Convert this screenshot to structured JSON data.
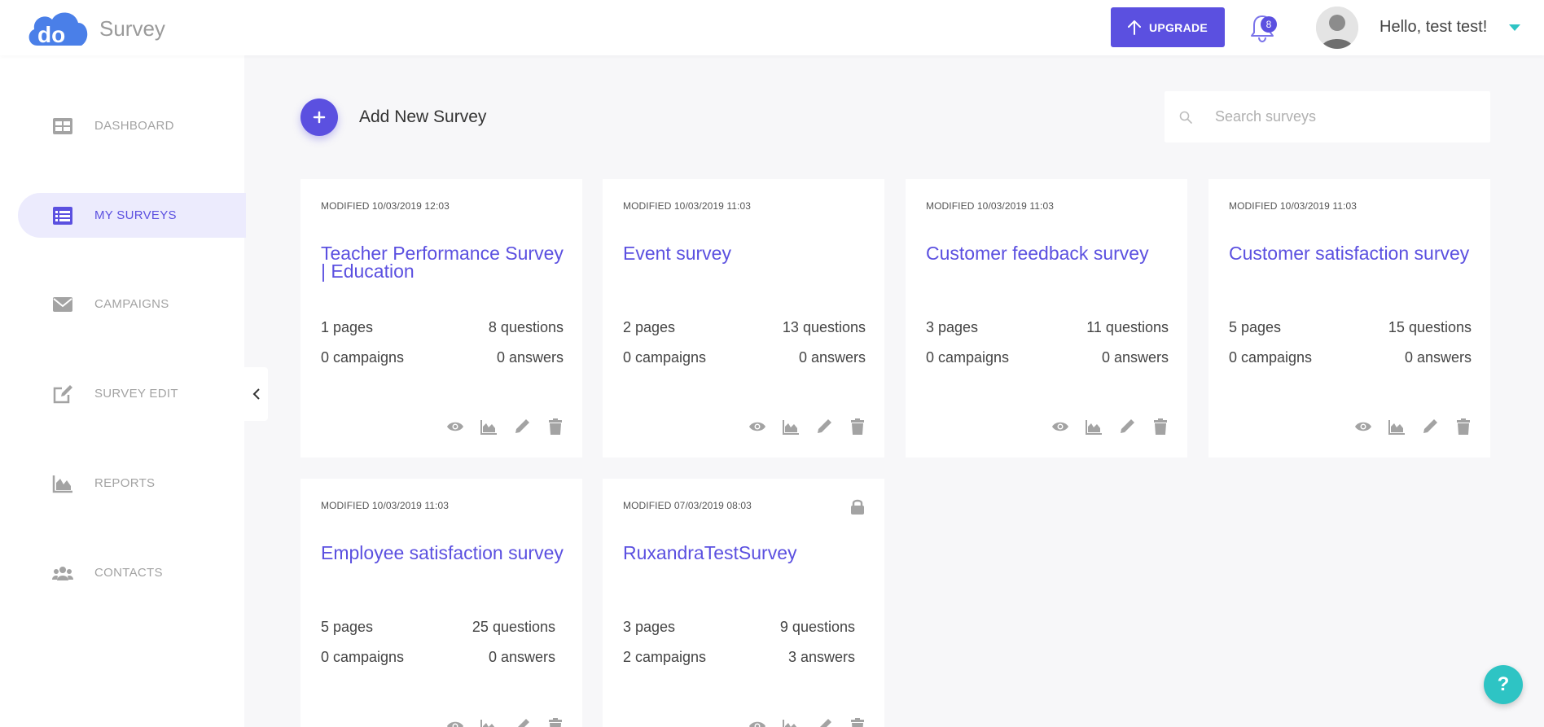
{
  "header": {
    "logo_text": "do",
    "app_title": "Survey",
    "upgrade_label": "UPGRADE",
    "notification_count": "8",
    "greeting": "Hello, test test!"
  },
  "sidebar": {
    "items": [
      {
        "label": "DASHBOARD",
        "icon": "dashboard-icon"
      },
      {
        "label": "MY SURVEYS",
        "icon": "list-icon",
        "active": true
      },
      {
        "label": "CAMPAIGNS",
        "icon": "envelope-icon"
      },
      {
        "label": "SURVEY EDIT",
        "icon": "edit-icon"
      },
      {
        "label": "REPORTS",
        "icon": "area-chart-icon"
      },
      {
        "label": "CONTACTS",
        "icon": "users-icon"
      }
    ]
  },
  "main": {
    "add_label": "Add New Survey",
    "search_placeholder": "Search surveys",
    "surveys": [
      {
        "modified": "MODIFIED 10/03/2019 12:03",
        "title": "Teacher Performance Survey | Education",
        "pages": "1 pages",
        "questions": "8 questions",
        "campaigns": "0 campaigns",
        "answers": "0 answers"
      },
      {
        "modified": "MODIFIED 10/03/2019 11:03",
        "title": "Event survey",
        "pages": "2 pages",
        "questions": "13 questions",
        "campaigns": "0 campaigns",
        "answers": "0 answers"
      },
      {
        "modified": "MODIFIED 10/03/2019 11:03",
        "title": "Customer feedback survey",
        "pages": "3 pages",
        "questions": "11 questions",
        "campaigns": "0 campaigns",
        "answers": "0 answers"
      },
      {
        "modified": "MODIFIED 10/03/2019 11:03",
        "title": "Customer satisfaction survey",
        "pages": "5 pages",
        "questions": "15 questions",
        "campaigns": "0 campaigns",
        "answers": "0 answers"
      },
      {
        "modified": "MODIFIED 10/03/2019 11:03",
        "title": "Employee satisfaction survey",
        "pages": "5 pages",
        "questions": "25 questions",
        "campaigns": "0 campaigns",
        "answers": "0 answers"
      },
      {
        "modified": "MODIFIED 07/03/2019 08:03",
        "title": "RuxandraTestSurvey",
        "pages": "3 pages",
        "questions": "9 questions",
        "campaigns": "2 campaigns",
        "answers": "3 answers",
        "locked": true
      }
    ]
  },
  "help_label": "?",
  "colors": {
    "accent": "#5b50e0",
    "teal": "#2ec4c4",
    "muted": "#a3a3a3"
  }
}
